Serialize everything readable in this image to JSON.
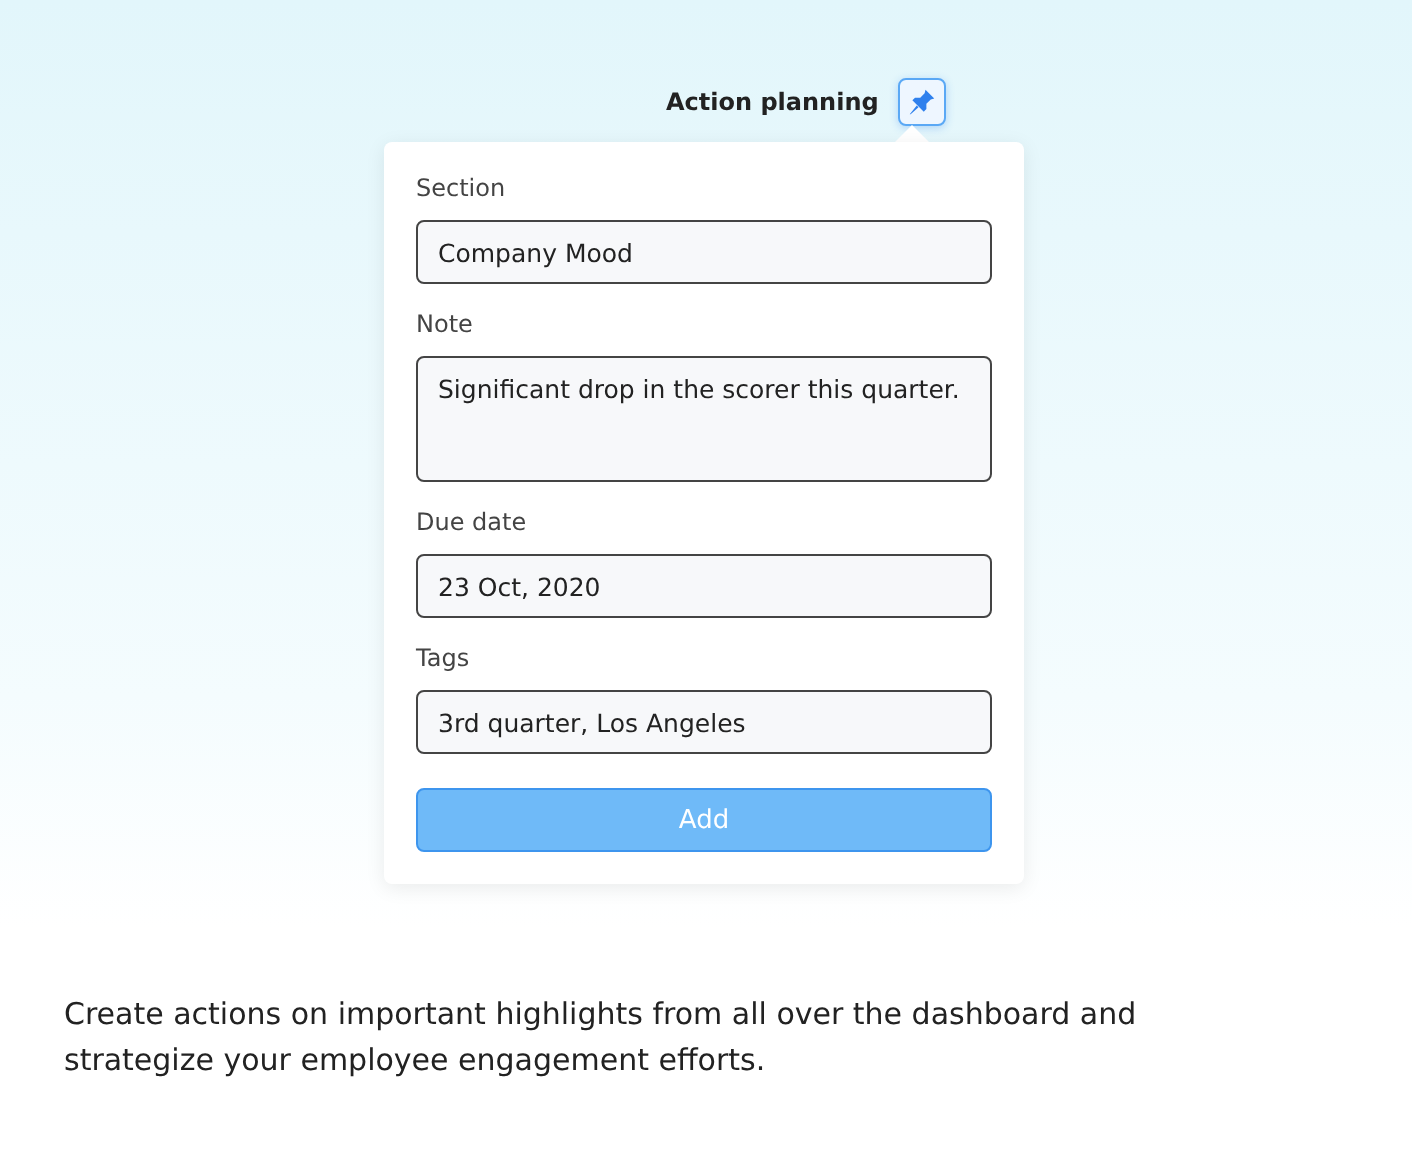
{
  "header": {
    "title": "Action planning",
    "pinned": true
  },
  "form": {
    "fields": [
      {
        "label": "Section",
        "value": "Company Mood",
        "kind": "input"
      },
      {
        "label": "Note",
        "value": "Significant drop in the scorer this quarter.",
        "kind": "textarea"
      },
      {
        "label": "Due date",
        "value": "23 Oct, 2020",
        "kind": "input"
      },
      {
        "label": "Tags",
        "value": "3rd quarter, Los Angeles",
        "kind": "input"
      }
    ],
    "submit": {
      "label": "Add",
      "disabled": true
    }
  },
  "description": "Create actions on important highlights from all over the dashboard and strategize your employee engagement efforts."
}
